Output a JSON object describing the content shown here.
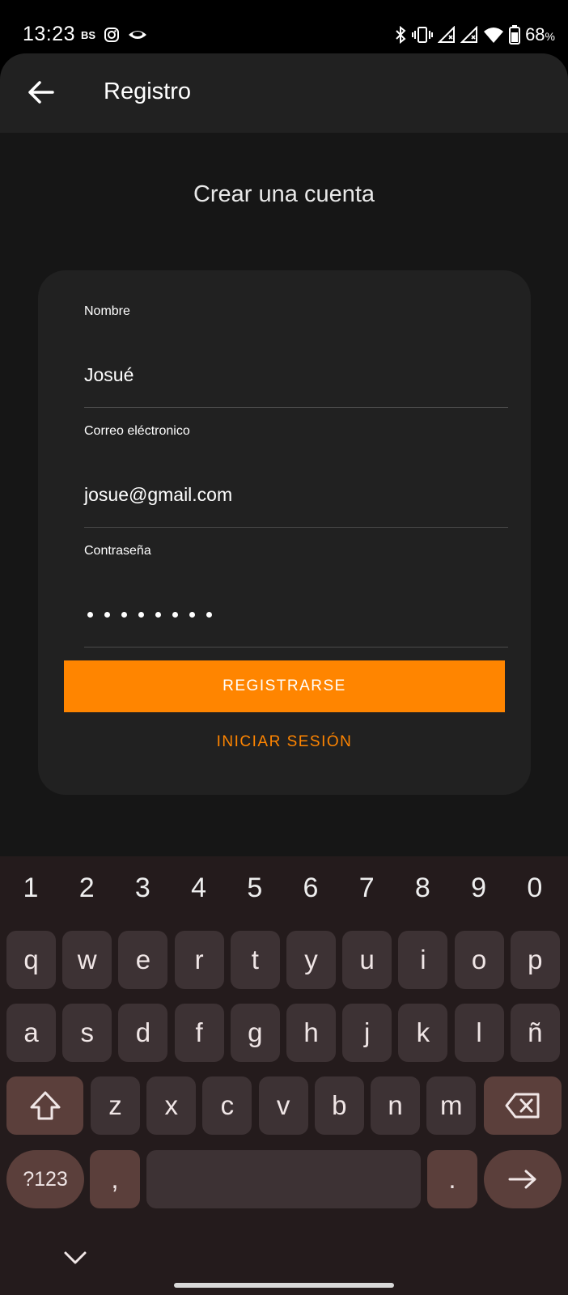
{
  "status_bar": {
    "time": "13:23",
    "left_icons": [
      "bs-app-icon",
      "instagram-icon",
      "eye-icon"
    ],
    "right_icons": [
      "bluetooth-icon",
      "vibrate-icon",
      "signal-icon",
      "signal-icon",
      "wifi-icon",
      "battery-icon"
    ],
    "battery_percent": "68",
    "battery_unit": "%"
  },
  "app_bar": {
    "title": "Registro",
    "back_icon": "arrow-left-icon"
  },
  "page": {
    "heading": "Crear una cuenta"
  },
  "form": {
    "name_label": "Nombre",
    "name_value": "Josué",
    "email_label": "Correo eléctronico",
    "email_value": "josue@gmail.com",
    "password_label": "Contraseña",
    "password_length": 8,
    "register_label": "REGISTRARSE",
    "login_label": "INICIAR SESIÓN"
  },
  "colors": {
    "accent": "#ff8500",
    "background": "#161616",
    "card": "#212121",
    "keyboard": "#241b1c"
  },
  "keyboard": {
    "numbers": [
      "1",
      "2",
      "3",
      "4",
      "5",
      "6",
      "7",
      "8",
      "9",
      "0"
    ],
    "row1": [
      "q",
      "w",
      "e",
      "r",
      "t",
      "y",
      "u",
      "i",
      "o",
      "p"
    ],
    "row2": [
      "a",
      "s",
      "d",
      "f",
      "g",
      "h",
      "j",
      "k",
      "l",
      "ñ"
    ],
    "row3": [
      "z",
      "x",
      "c",
      "v",
      "b",
      "n",
      "m"
    ],
    "symbols_label": "?123",
    "comma": ",",
    "period": ".",
    "shift_icon": "shift-icon",
    "backspace_icon": "backspace-icon",
    "enter_icon": "arrow-right-icon",
    "hide_icon": "chevron-down-icon"
  }
}
